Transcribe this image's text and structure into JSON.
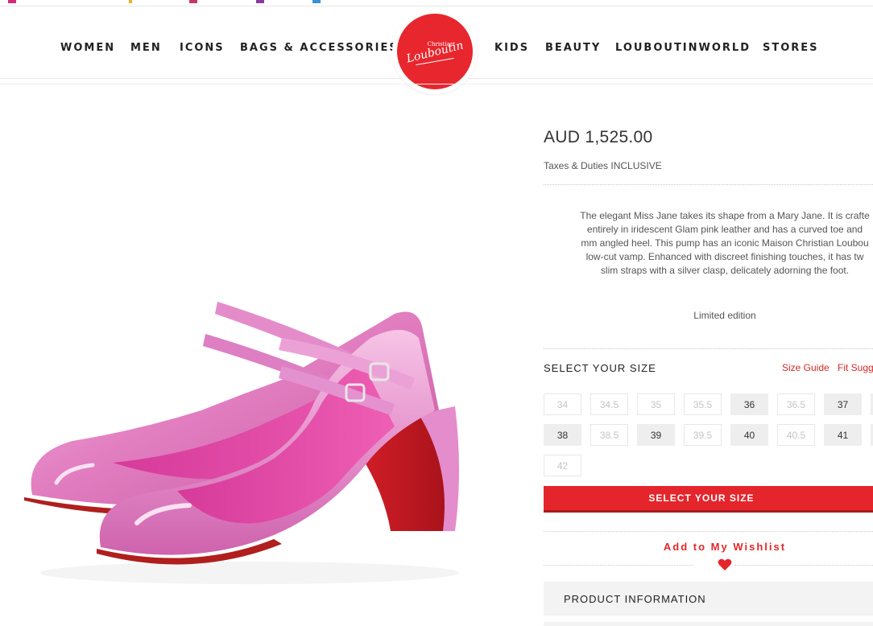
{
  "nav": {
    "left": [
      "WOMEN",
      "MEN",
      "ICONS",
      "BAGS & ACCESSORIES"
    ],
    "right": [
      "KIDS",
      "BEAUTY",
      "LOUBOUTINWORLD",
      "STORES"
    ]
  },
  "logo": {
    "line1": "Christian",
    "line2": "Louboutin"
  },
  "product": {
    "price": "AUD 1,525.00",
    "taxes": "Taxes & Duties INCLUSIVE",
    "description_lines": [
      "The elegant Miss Jane takes its shape from a Mary Jane. It is crafte",
      "entirely in iridescent Glam pink leather and has a curved toe and",
      "mm angled heel. This pump has an iconic Maison Christian Loubou",
      "low-cut vamp. Enhanced with discreet finishing touches, it has tw",
      "slim straps with a silver clasp, delicately adorning the foot."
    ],
    "limited": "Limited edition"
  },
  "sizes": {
    "title": "SELECT YOUR SIZE",
    "size_guide": "Size Guide",
    "fit": "Fit Sugg",
    "options": [
      {
        "label": "34",
        "available": false
      },
      {
        "label": "34.5",
        "available": false
      },
      {
        "label": "35",
        "available": false
      },
      {
        "label": "35.5",
        "available": false
      },
      {
        "label": "36",
        "available": true
      },
      {
        "label": "36.5",
        "available": false
      },
      {
        "label": "37",
        "available": true
      },
      {
        "label": "38",
        "available": true
      },
      {
        "label": "38.5",
        "available": false
      },
      {
        "label": "39",
        "available": true
      },
      {
        "label": "39.5",
        "available": false
      },
      {
        "label": "40",
        "available": true
      },
      {
        "label": "40.5",
        "available": false
      },
      {
        "label": "41",
        "available": true
      },
      {
        "label": "42",
        "available": false
      }
    ]
  },
  "actions": {
    "select_size_button": "SELECT YOUR SIZE",
    "wishlist": "Add to My Wishlist"
  },
  "accordion": {
    "product_information": "PRODUCT INFORMATION"
  },
  "colors": {
    "brand_red": "#e4262c",
    "shoe_pink": "#e681c4",
    "sole_red": "#c8191e"
  }
}
